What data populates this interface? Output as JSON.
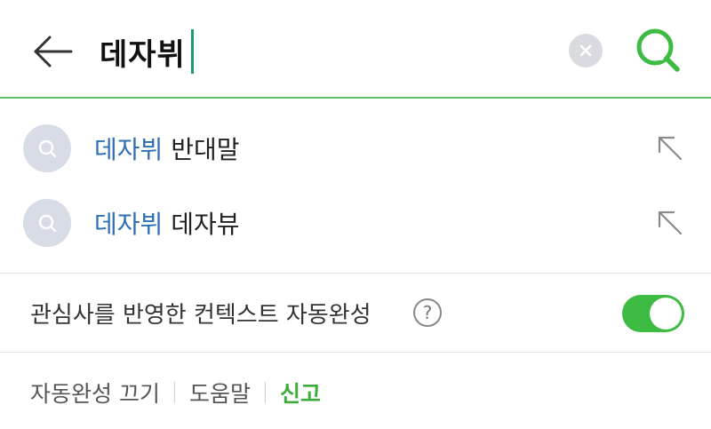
{
  "search": {
    "query": "데자뷔",
    "clear_icon": "close-icon",
    "submit_icon": "search-icon",
    "accent_color": "#3dbb43"
  },
  "suggestions": [
    {
      "match": "데자뷔",
      "rest": "반대말",
      "icon": "search-icon",
      "action_icon": "arrow-up-left-icon"
    },
    {
      "match": "데자뷔",
      "rest": "데자뷰",
      "icon": "search-icon",
      "action_icon": "arrow-up-left-icon"
    }
  ],
  "context_autocomplete": {
    "label": "관심사를 반영한 컨텍스트 자동완성",
    "help_symbol": "?",
    "enabled": true
  },
  "footer": {
    "autocomplete_off": "자동완성 끄기",
    "help": "도움말",
    "report": "신고"
  }
}
